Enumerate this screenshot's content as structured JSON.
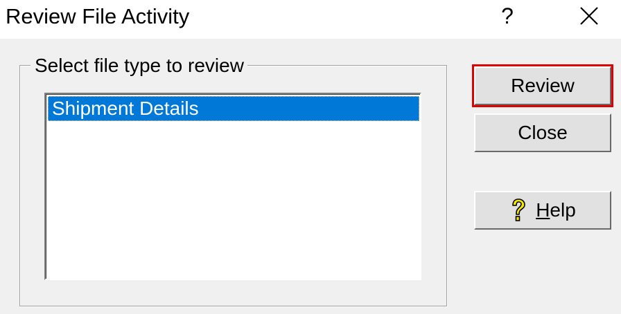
{
  "window": {
    "title": "Review File Activity",
    "help_glyph": "?",
    "close_glyph": "close-icon"
  },
  "group": {
    "legend": "Select file type to review",
    "list_items": [
      {
        "label": "Shipment Details",
        "selected": true
      }
    ]
  },
  "buttons": {
    "review_label": "Review",
    "close_label": "Close",
    "help_mnemonic": "H",
    "help_rest": "elp",
    "help_icon": "question-mark-icon"
  },
  "colors": {
    "selection": "#0078d7",
    "highlight_border": "#e00000",
    "dialog_bg": "#f0f0f0",
    "help_icon_fill": "#f6e600"
  }
}
